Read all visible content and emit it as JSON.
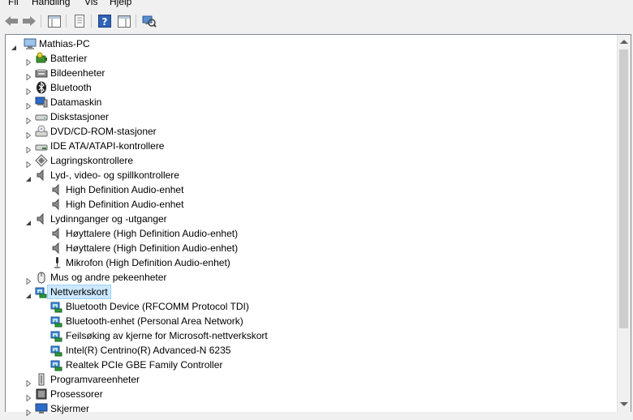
{
  "menu": [
    "Fil",
    "Handling",
    "Vis",
    "Hjelp"
  ],
  "toolbar": {
    "buttons": [
      "back-icon",
      "forward-icon",
      "console-tree-icon",
      "properties-icon",
      "help-icon",
      "action-pane-icon",
      "scan-hardware-icon"
    ]
  },
  "tree": {
    "root": "Mathias-PC",
    "selected": "Nettverkskort",
    "items": [
      {
        "label": "Batterier",
        "icon": "battery-icon",
        "expanded": false
      },
      {
        "label": "Bildeenheter",
        "icon": "imaging-device-icon",
        "expanded": false
      },
      {
        "label": "Bluetooth",
        "icon": "bluetooth-icon",
        "expanded": false
      },
      {
        "label": "Datamaskin",
        "icon": "computer-icon",
        "expanded": false
      },
      {
        "label": "Diskstasjoner",
        "icon": "disk-drive-icon",
        "expanded": false
      },
      {
        "label": "DVD/CD-ROM-stasjoner",
        "icon": "dvd-drive-icon",
        "expanded": false
      },
      {
        "label": "IDE ATA/ATAPI-kontrollere",
        "icon": "ide-controller-icon",
        "expanded": false
      },
      {
        "label": "Lagringskontrollere",
        "icon": "storage-controller-icon",
        "expanded": false
      },
      {
        "label": "Lyd-, video- og spillkontrollere",
        "icon": "speaker-icon",
        "expanded": true,
        "children": [
          {
            "label": "High Definition Audio-enhet",
            "icon": "speaker-icon"
          },
          {
            "label": "High Definition Audio-enhet",
            "icon": "speaker-icon"
          }
        ]
      },
      {
        "label": "Lydinnganger og -utganger",
        "icon": "speaker-icon",
        "expanded": true,
        "children": [
          {
            "label": "Høyttalere (High Definition Audio-enhet)",
            "icon": "speaker-icon"
          },
          {
            "label": "Høyttalere (High Definition Audio-enhet)",
            "icon": "speaker-icon"
          },
          {
            "label": "Mikrofon (High Definition Audio-enhet)",
            "icon": "microphone-icon"
          }
        ]
      },
      {
        "label": "Mus og andre pekeenheter",
        "icon": "mouse-icon",
        "expanded": false
      },
      {
        "label": "Nettverkskort",
        "icon": "network-adapter-icon",
        "expanded": true,
        "children": [
          {
            "label": "Bluetooth Device (RFCOMM Protocol TDI)",
            "icon": "network-adapter-icon"
          },
          {
            "label": "Bluetooth-enhet (Personal Area Network)",
            "icon": "network-adapter-icon"
          },
          {
            "label": "Feilsøking av kjerne for Microsoft-nettverkskort",
            "icon": "network-adapter-icon"
          },
          {
            "label": "Intel(R) Centrino(R) Advanced-N 6235",
            "icon": "network-adapter-icon"
          },
          {
            "label": "Realtek PCIe GBE Family Controller",
            "icon": "network-adapter-icon"
          }
        ]
      },
      {
        "label": "Programvareenheter",
        "icon": "software-device-icon",
        "expanded": false
      },
      {
        "label": "Prosessorer",
        "icon": "processor-icon",
        "expanded": false
      },
      {
        "label": "Skjermer",
        "icon": "monitor-icon",
        "expanded": false
      }
    ]
  }
}
